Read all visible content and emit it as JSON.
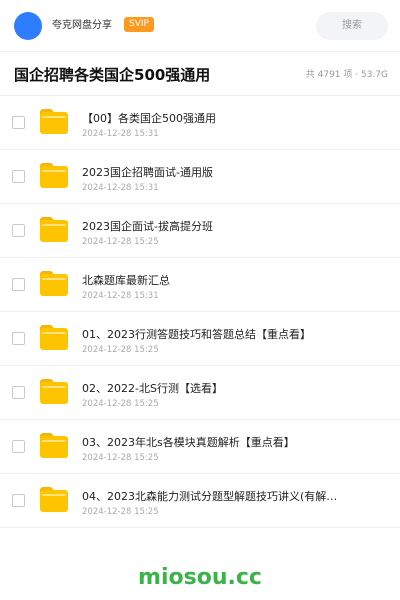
{
  "topbar": {
    "username": "夸克网盘分享",
    "badge": "SVIP",
    "search_label": "搜索"
  },
  "header": {
    "title": "国企招聘各类国企500强通用",
    "meta": "共 4791 项 · 53.7G"
  },
  "files": [
    {
      "name": "【00】各类国企500强通用",
      "date": "2024-12-28 15:31"
    },
    {
      "name": "2023国企招聘面试-通用版",
      "date": "2024-12-28 15:31"
    },
    {
      "name": "2023国企面试-拔高提分班",
      "date": "2024-12-28 15:25"
    },
    {
      "name": "北森题库最新汇总",
      "date": "2024-12-28 15:31"
    },
    {
      "name": "01、2023行测答题技巧和答题总结【重点看】",
      "date": "2024-12-28 15:25"
    },
    {
      "name": "02、2022-北S行测【选看】",
      "date": "2024-12-28 15:25"
    },
    {
      "name": "03、2023年北s各模块真题解析【重点看】",
      "date": "2024-12-28 15:25"
    },
    {
      "name": "04、2023北森能力测试分题型解题技巧讲义(有解…",
      "date": "2024-12-28 15:25"
    }
  ],
  "watermark": "miosou.cc",
  "colors": {
    "avatar": "#2f7dff",
    "badge": "#ff9a1f",
    "folder": "#ffc400",
    "watermark": "#3cb34a"
  },
  "icons": {
    "folder": "folder-icon",
    "checkbox": "checkbox-icon"
  }
}
